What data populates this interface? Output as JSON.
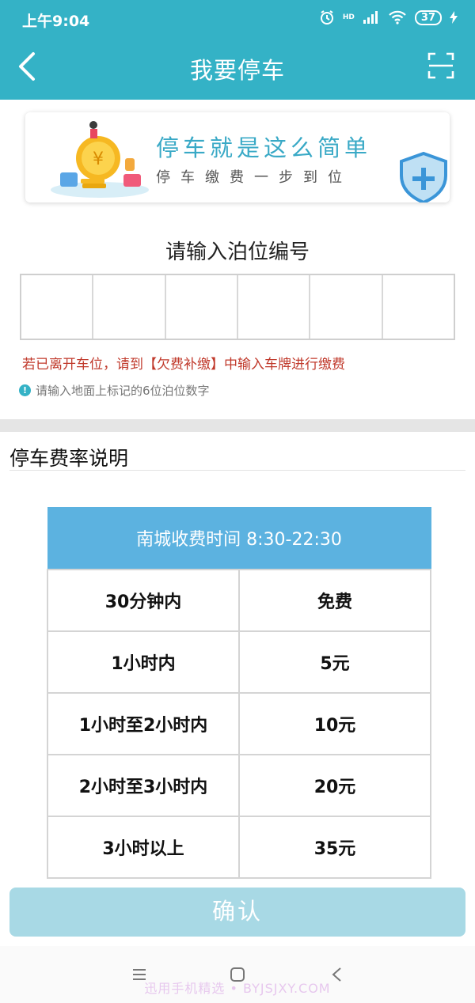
{
  "status_bar": {
    "time": "上午9:04",
    "signal_label": "HD",
    "battery": "37"
  },
  "nav": {
    "title": "我要停车"
  },
  "banner": {
    "title": "停车就是这么简单",
    "subtitle": "停车缴费一步到位"
  },
  "berth": {
    "label": "请输入泊位编号",
    "digits": [
      "",
      "",
      "",
      "",
      "",
      ""
    ],
    "warning": "若已离开车位，请到【欠费补缴】中输入车牌进行缴费",
    "hint": "请输入地面上标记的6位泊位数字"
  },
  "rates": {
    "section_title": "停车费率说明",
    "table_header": "南城收费时间 8:30-22:30",
    "rows": [
      {
        "duration": "30分钟内",
        "fee": "免费"
      },
      {
        "duration": "1小时内",
        "fee": "5元"
      },
      {
        "duration": "1小时至2小时内",
        "fee": "10元"
      },
      {
        "duration": "2小时至3小时内",
        "fee": "20元"
      },
      {
        "duration": "3小时以上",
        "fee": "35元"
      }
    ]
  },
  "confirm_button": "确认",
  "watermark": "迅用手机精选 • BYJSJXY.COM",
  "colors": {
    "primary": "#34b2c6",
    "table_header": "#5cb2e0",
    "confirm_disabled": "#a8d9e5",
    "warning": "#c0392b"
  }
}
